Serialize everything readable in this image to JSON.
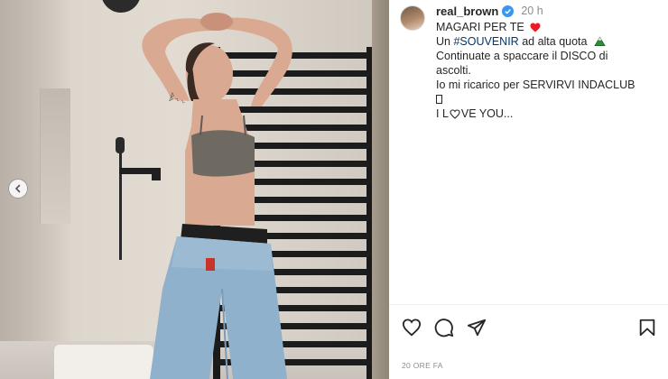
{
  "post": {
    "username": "real_brown",
    "verified": true,
    "time_ago": "20 h",
    "caption": {
      "line1": "MAGARI PER TE",
      "line2_prefix": "Un",
      "line2_hashtag": "#SOUVENIR",
      "line2_suffix": "ad alta quota",
      "line3": "Continuate a spaccare il DISCO di",
      "line4": "ascolti.",
      "line5": "Io mi ricarico per SERVIRVI INDACLUB",
      "line7_a": "I L",
      "line7_b": "VE YOU..."
    },
    "date_label": "20 ORE FA"
  },
  "icons": {
    "like": "heart-outline-icon",
    "comment": "comment-bubble-icon",
    "share": "paper-plane-icon",
    "save": "bookmark-icon",
    "carousel_prev": "chevron-left-icon",
    "verified": "verified-badge-icon"
  },
  "colors": {
    "text": "#262626",
    "muted": "#8e8e8e",
    "hashtag": "#00376b",
    "verified": "#3897f0",
    "heart": "#ed1c24"
  }
}
